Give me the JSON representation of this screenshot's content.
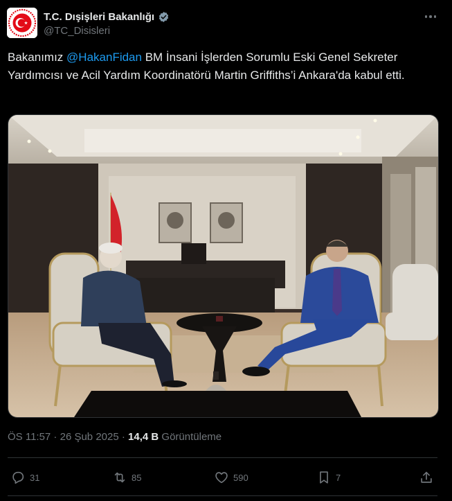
{
  "account": {
    "display_name": "T.C. Dışişleri Bakanlığı",
    "handle": "@TC_Disisleri",
    "verified": true,
    "avatar": "turkish-foreign-ministry-logo"
  },
  "tweet": {
    "text_before_mention": "Bakanımız ",
    "mention": "@HakanFidan",
    "text_after_mention": " BM İnsani İşlerden Sorumlu Eski Genel Sekreter Yardımcısı ve Acil Yardım Koordinatörü Martin Griffiths’i Ankara'da kabul etti.",
    "image": {
      "description_icon": "photo-two-men-seated-in-office"
    }
  },
  "meta": {
    "time": "ÖS 11:57",
    "separator": " · ",
    "date": "26 Şub 2025",
    "views_count": "14,4 B",
    "views_label": "Görüntüleme"
  },
  "actions": {
    "replies": "31",
    "reposts": "85",
    "likes": "590",
    "bookmarks": "7"
  },
  "colors": {
    "background": "#000000",
    "text": "#e7e9ea",
    "secondary": "#71767b",
    "link": "#1d9bf0",
    "border": "#2f3336",
    "verified_badge": "#829aab",
    "logo_red": "#e30a17"
  }
}
